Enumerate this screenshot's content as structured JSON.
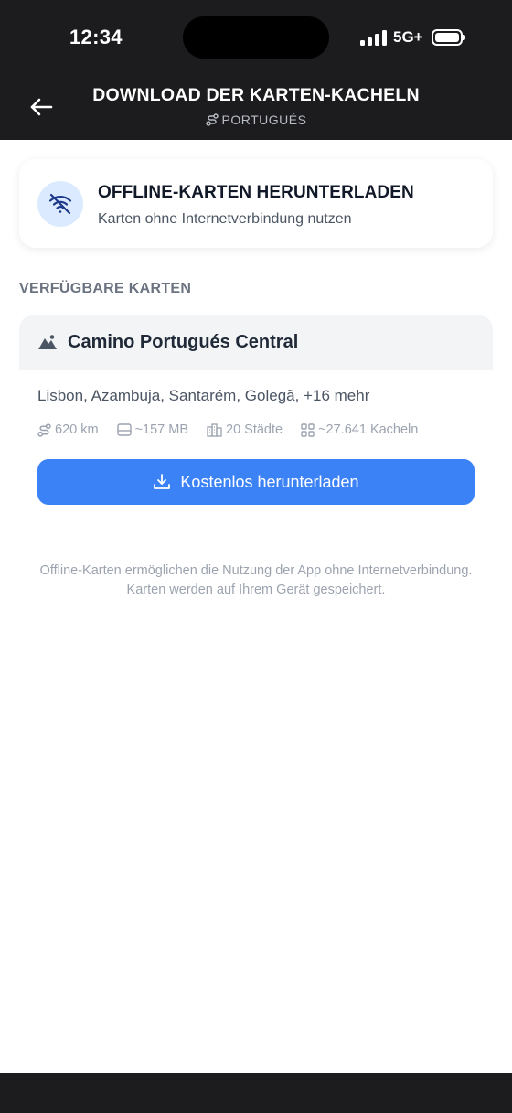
{
  "status": {
    "time": "12:34",
    "network": "5G+"
  },
  "header": {
    "title": "DOWNLOAD DER KARTEN-KACHELN",
    "subtitle": "PORTUGUÉS"
  },
  "offline_card": {
    "title": "OFFLINE-KARTEN HERUNTERLADEN",
    "subtitle": "Karten ohne Internetverbindung nutzen",
    "icon": "wifi-off-icon"
  },
  "section_label": "VERFÜGBARE KARTEN",
  "map": {
    "name": "Camino Portugués Central",
    "cities": "Lisbon, Azambuja, Santarém, Golegã, +16 mehr",
    "distance": "620 km",
    "size": "~157 MB",
    "towns": "20 Städte",
    "tiles": "~27.641 Kacheln",
    "button": "Kostenlos herunterladen"
  },
  "footnote": "Offline-Karten ermöglichen die Nutzung der App ohne Internetverbindung. Karten werden auf Ihrem Gerät gespeichert.",
  "colors": {
    "header_bg": "#1c1c1e",
    "accent": "#3b82f6",
    "icon_bg": "#dbeafe"
  }
}
